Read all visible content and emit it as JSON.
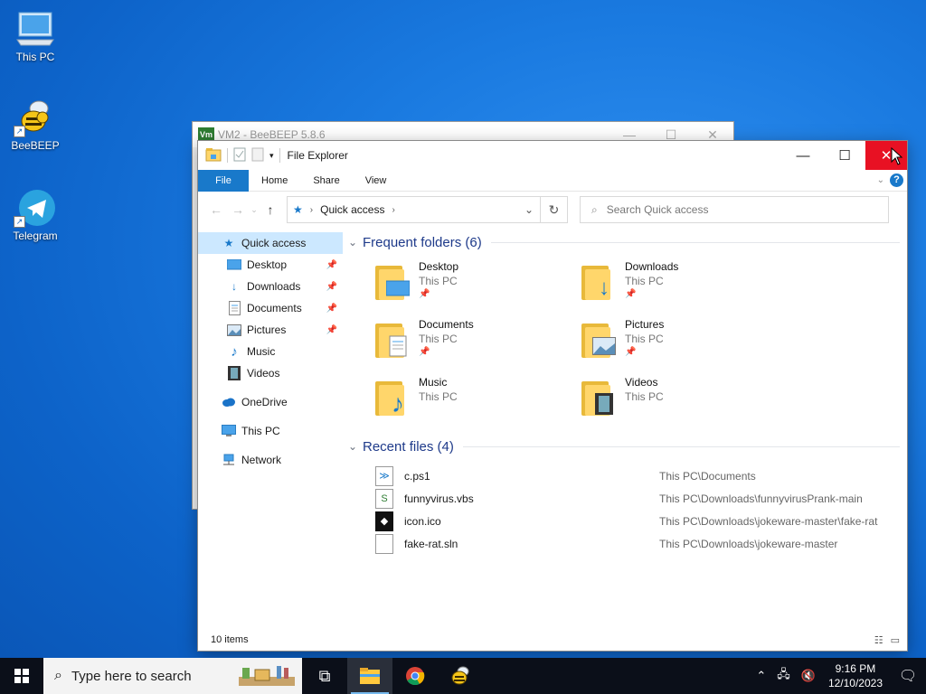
{
  "desktop": {
    "icons": [
      {
        "label": "This PC",
        "icon": "computer-icon"
      },
      {
        "label": "BeeBEEP",
        "icon": "bee-icon"
      },
      {
        "label": "Telegram",
        "icon": "telegram-icon"
      }
    ]
  },
  "background_window": {
    "badge": "Vm",
    "title": "VM2 - BeeBEEP 5.8.6"
  },
  "explorer": {
    "title": "File Explorer",
    "ribbon": {
      "file": "File",
      "home": "Home",
      "share": "Share",
      "view": "View"
    },
    "address": {
      "location": "Quick access"
    },
    "search": {
      "placeholder": "Search Quick access"
    },
    "nav": {
      "quick_access": "Quick access",
      "desktop": "Desktop",
      "downloads": "Downloads",
      "documents": "Documents",
      "pictures": "Pictures",
      "music": "Music",
      "videos": "Videos",
      "onedrive": "OneDrive",
      "this_pc": "This PC",
      "network": "Network"
    },
    "frequent": {
      "header": "Frequent folders (6)",
      "folders": [
        {
          "name": "Desktop",
          "location": "This PC",
          "pinned": true
        },
        {
          "name": "Downloads",
          "location": "This PC",
          "pinned": true
        },
        {
          "name": "Documents",
          "location": "This PC",
          "pinned": true
        },
        {
          "name": "Pictures",
          "location": "This PC",
          "pinned": true
        },
        {
          "name": "Music",
          "location": "This PC",
          "pinned": false
        },
        {
          "name": "Videos",
          "location": "This PC",
          "pinned": false
        }
      ]
    },
    "recent": {
      "header": "Recent files (4)",
      "files": [
        {
          "name": "c.ps1",
          "path": "This PC\\Documents"
        },
        {
          "name": "funnyvirus.vbs",
          "path": "This PC\\Downloads\\funnyvirusPrank-main"
        },
        {
          "name": "icon.ico",
          "path": "This PC\\Downloads\\jokeware-master\\fake-rat"
        },
        {
          "name": "fake-rat.sln",
          "path": "This PC\\Downloads\\jokeware-master"
        }
      ]
    },
    "status": {
      "items": "10 items"
    }
  },
  "taskbar": {
    "search_placeholder": "Type here to search",
    "time": "9:16 PM",
    "date": "12/10/2023"
  },
  "colors": {
    "accent": "#1979ca",
    "close_red": "#e81123",
    "selection": "#cce8ff",
    "folder_yellow": "#ffd66b"
  }
}
